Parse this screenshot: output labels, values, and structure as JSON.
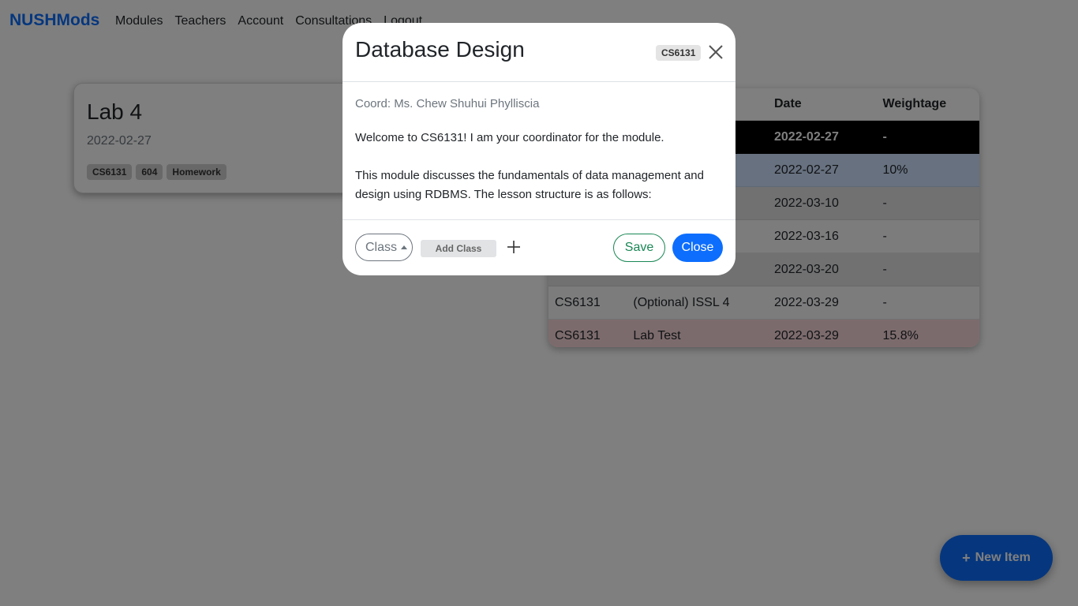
{
  "navbar": {
    "brand": "NUSHMods",
    "links": [
      "Modules",
      "Teachers",
      "Account",
      "Consultations",
      "Logout"
    ]
  },
  "card": {
    "title": "Lab 4",
    "date": "2022-02-27",
    "badges": [
      "CS6131",
      "604",
      "Homework"
    ]
  },
  "table": {
    "headers": [
      "",
      "",
      "Date",
      "Weightage"
    ],
    "rows": [
      {
        "module": "",
        "name": "",
        "date": "2022-02-27",
        "weightage": "-"
      },
      {
        "module": "",
        "name": "",
        "date": "2022-02-27",
        "weightage": "10%"
      },
      {
        "module": "",
        "name": "",
        "date": "2022-03-10",
        "weightage": "-"
      },
      {
        "module": "",
        "name": "",
        "date": "2022-03-16",
        "weightage": "-"
      },
      {
        "module": "",
        "name": "",
        "date": "2022-03-20",
        "weightage": "-"
      },
      {
        "module": "CS6131",
        "name": "(Optional) ISSL 4",
        "date": "2022-03-29",
        "weightage": "-"
      },
      {
        "module": "CS6131",
        "name": "Lab Test",
        "date": "2022-03-29",
        "weightage": "15.8%"
      }
    ]
  },
  "fab": {
    "label": "New Item",
    "icon": "plus-icon"
  },
  "modal": {
    "title": "Database Design",
    "badge": "CS6131",
    "coord": "Coord: Ms. Chew Shuhui Phylliscia",
    "desc": [
      "Welcome to CS6131! I am your coordinator for the module.",
      "This module discusses the fundamentals of data management and design using RDBMS. The lesson structure is as follows:"
    ],
    "class_select": "Class",
    "add_class": "Add Class",
    "save": "Save",
    "close": "Close"
  },
  "colors": {
    "primary": "#0d6efd",
    "success": "#198754",
    "row_blue": "#cfe2ff",
    "row_red": "#f8d7da"
  }
}
